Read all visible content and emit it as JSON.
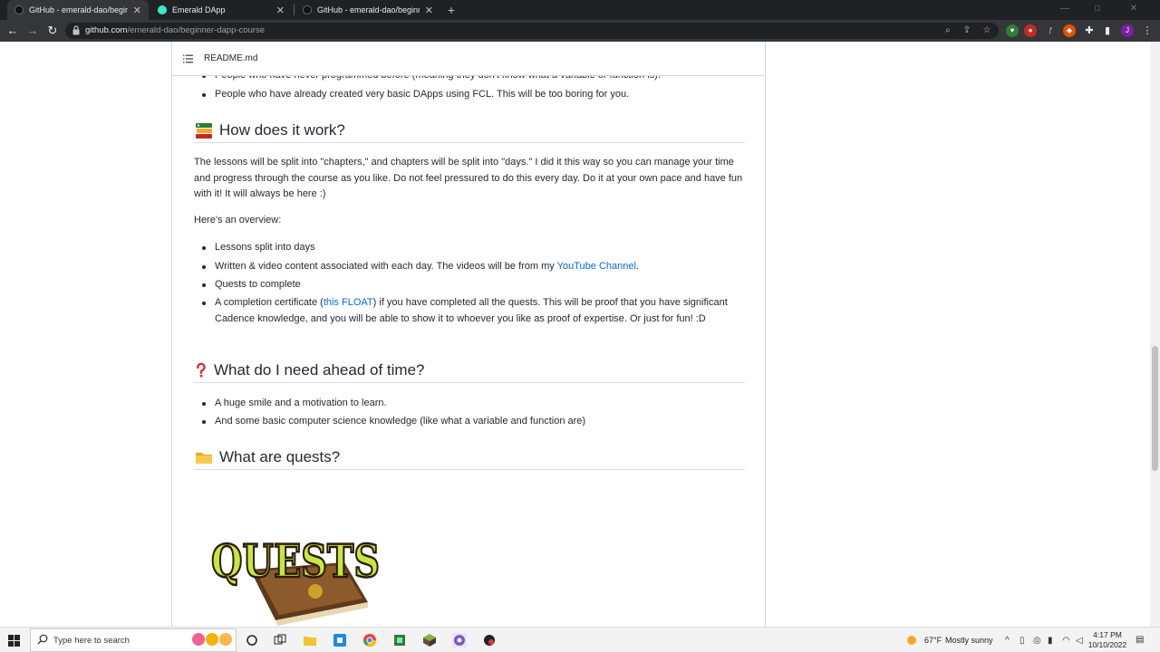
{
  "tabs": [
    {
      "title": "GitHub - emerald-dao/beginner-",
      "active": true
    },
    {
      "title": "Emerald DApp",
      "active": false
    },
    {
      "title": "GitHub - emerald-dao/beginner-",
      "active": false
    }
  ],
  "omnibox": {
    "domain": "github.com",
    "path": "/emerald-dao/beginner-dapp-course"
  },
  "readme_header": {
    "title": "README.md"
  },
  "content": {
    "top_list": [
      "People who have never programmed before (meaning they don't know what a variable or function is).",
      "People who have already created very basic DApps using FCL. This will be too boring for you."
    ],
    "how": {
      "heading": "How does it work?",
      "para1": "The lessons will be split into \"chapters,\" and chapters will be split into \"days.\" I did it this way so you can manage your time and progress through the course as you like. Do not feel pressured to do this every day. Do it at your own pace and have fun with it! It will always be here :)",
      "para2": "Here's an overview:",
      "item1": "Lessons split into days",
      "item2_pre": "Written & video content associated with each day. The videos will be from my ",
      "item2_link": "YouTube Channel",
      "item2_post": ".",
      "item3": "Quests to complete",
      "item4_pre": "A completion certificate (",
      "item4_link": "this FLOAT",
      "item4_post": ") if you have completed all the quests. This will be proof that you have significant Cadence knowledge, and you will be able to show it to whoever you like as proof of expertise. Or just for fun! :D"
    },
    "need": {
      "heading": "What do I need ahead of time?",
      "item1": "A huge smile and a motivation to learn.",
      "item2": "And some basic computer science knowledge (like what a variable and function are)"
    },
    "quests": {
      "heading": "What are quests?",
      "image_text": "QUESTS"
    }
  },
  "taskbar": {
    "search_placeholder": "Type here to search",
    "weather_temp": "67°F",
    "weather_desc": "Mostly sunny",
    "time": "4:17 PM",
    "date": "10/10/2022"
  },
  "colors": {
    "link": "#0969da",
    "text": "#24292f",
    "border": "#d0d7de"
  }
}
